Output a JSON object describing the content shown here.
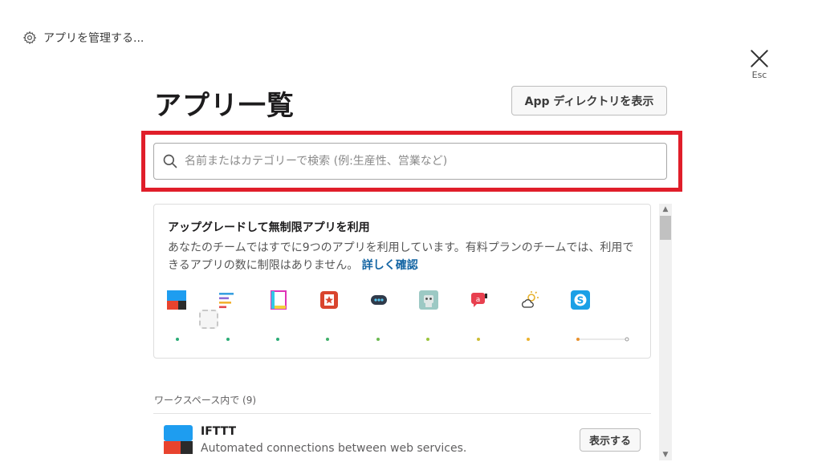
{
  "header": {
    "manage_label": "アプリを管理する...",
    "close_label": "Esc"
  },
  "main": {
    "title": "アプリ一覧",
    "directory_button": "App ディレクトリを表示",
    "search": {
      "placeholder": "名前またはカテゴリーで検索 (例:生産性、営業など)",
      "value": ""
    }
  },
  "upgrade_card": {
    "title": "アップグレードして無制限アプリを利用",
    "description": "あなたのチームではすでに9つのアプリを利用しています。有料プランのチームでは、利用できるアプリの数に制限はありません。",
    "link": "詳しく確認",
    "icons": [
      "ifttt-icon",
      "lines-icon",
      "doc-icon",
      "star-app-icon",
      "bot-icon",
      "robot-icon",
      "chat-bubble-icon",
      "weather-icon",
      "skype-icon"
    ]
  },
  "workspace_section": {
    "label": "ワークスペース内で (9)",
    "apps": [
      {
        "name": "IFTTT",
        "description": "Automated connections between web services.",
        "button": "表示する"
      }
    ]
  },
  "colors": {
    "highlight": "#e01e2a",
    "link": "#1264a3"
  }
}
